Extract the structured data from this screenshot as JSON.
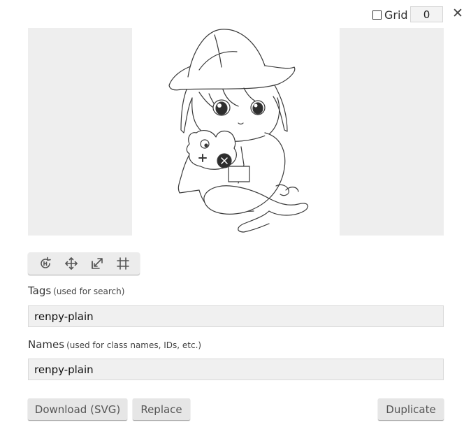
{
  "grid": {
    "label": "Grid",
    "checked": false,
    "value": "0"
  },
  "close": {
    "glyph": "✕"
  },
  "preview": {
    "image_subject": "chibi girl in explorer hat holding frog plush and snake (renpy mascot, line art)"
  },
  "toolbar": {
    "tools": [
      "rotate-icon",
      "move-icon",
      "resize-icon",
      "crop-icon"
    ]
  },
  "tags": {
    "label": "Tags",
    "hint": "(used for search)",
    "value": "renpy-plain"
  },
  "names": {
    "label": "Names",
    "hint": "(used for class names, IDs, etc.)",
    "value": "renpy-plain"
  },
  "buttons": {
    "download": "Download (SVG)",
    "replace": "Replace",
    "duplicate": "Duplicate"
  },
  "colors": {
    "panel_bg": "#eeeeee",
    "field_bg": "#f0f0f0",
    "button_bg": "#e6e6e6",
    "text": "#333333"
  }
}
